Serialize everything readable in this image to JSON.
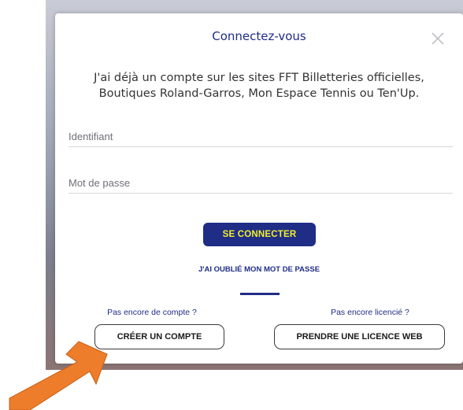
{
  "modal": {
    "title": "Connectez-vous",
    "intro_line1": "J'ai déjà un compte sur les sites FFT Billetteries officielles,",
    "intro_line2": "Boutiques Roland-Garros, Mon Espace Tennis ou Ten'Up.",
    "login_placeholder": "Identifiant",
    "password_placeholder": "Mot de passe",
    "login_button": "SE CONNECTER",
    "forgot_link": "J'AI OUBLIÉ MON MOT DE PASSE",
    "no_account_hint": "Pas encore de compte ?",
    "create_account_button": "CRÉER UN COMPTE",
    "no_licence_hint": "Pas encore licencié ?",
    "licence_button": "PRENDRE UNE LICENCE WEB"
  },
  "colors": {
    "brand_blue": "#1f2d86",
    "accent_yellow": "#f2ee2d",
    "annotation_arrow": "#ee7d2b"
  },
  "icons": {
    "close": "close-icon",
    "arrow": "annotation-arrow"
  }
}
